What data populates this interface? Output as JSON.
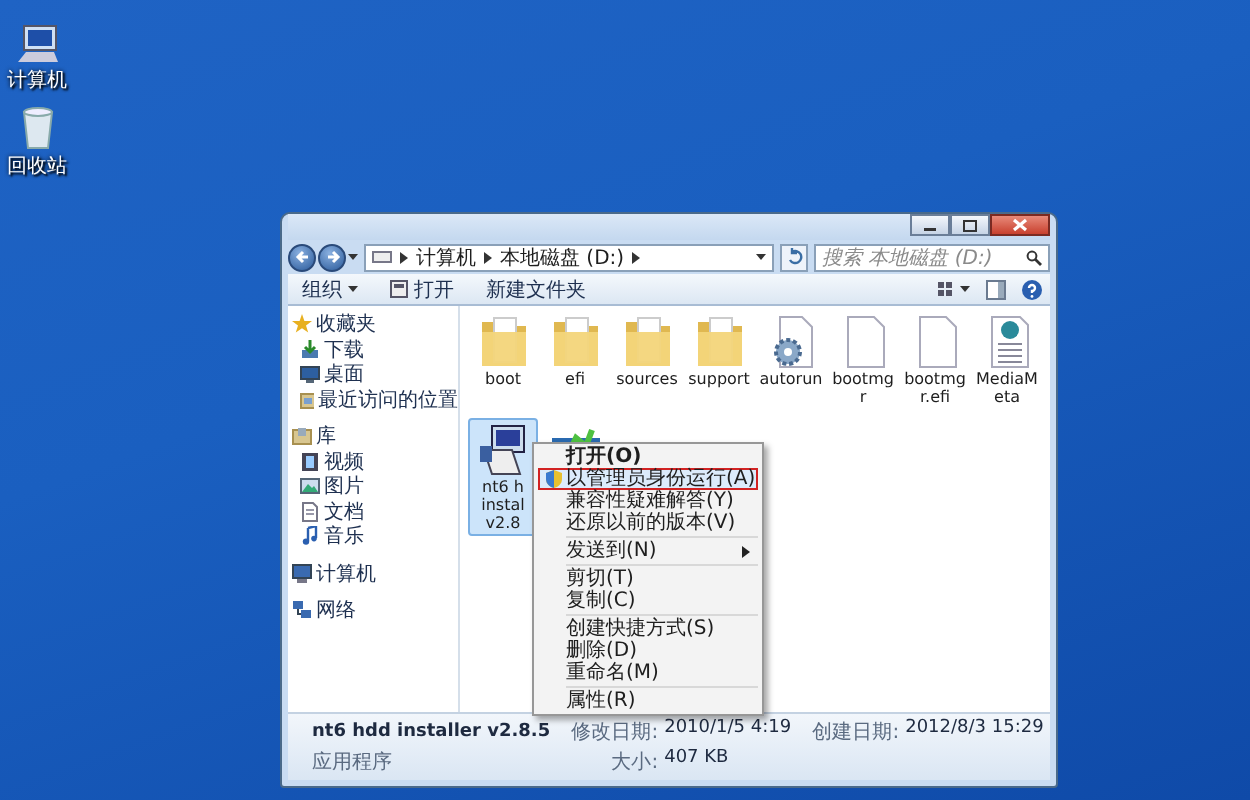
{
  "desktop_icons": [
    {
      "label": "计算机",
      "kind": "computer"
    },
    {
      "label": "回收站",
      "kind": "recycle"
    }
  ],
  "address_bar": {
    "breadcrumb": [
      "计算机",
      "本地磁盘 (D:)"
    ]
  },
  "search": {
    "placeholder": "搜索 本地磁盘 (D:)"
  },
  "toolbar": {
    "items": [
      {
        "label": "组织",
        "kind": "dropdown"
      },
      {
        "label": "打开",
        "kind": "open"
      },
      {
        "label": "新建文件夹",
        "kind": "plain"
      }
    ]
  },
  "sidebar": {
    "groups": [
      {
        "label": "收藏夹",
        "kind": "star",
        "children": [
          {
            "label": "下载",
            "kind": "download"
          },
          {
            "label": "桌面",
            "kind": "desktop"
          },
          {
            "label": "最近访问的位置",
            "kind": "recent"
          }
        ]
      },
      {
        "label": "库",
        "kind": "library",
        "children": [
          {
            "label": "视频",
            "kind": "video"
          },
          {
            "label": "图片",
            "kind": "picture"
          },
          {
            "label": "文档",
            "kind": "document"
          },
          {
            "label": "音乐",
            "kind": "music"
          }
        ]
      },
      {
        "label": "计算机",
        "kind": "computer"
      },
      {
        "label": "网络",
        "kind": "network"
      }
    ]
  },
  "files": [
    {
      "name": "boot",
      "kind": "folder",
      "selected": false
    },
    {
      "name": "efi",
      "kind": "folder",
      "selected": false
    },
    {
      "name": "sources",
      "kind": "folder",
      "selected": false
    },
    {
      "name": "support",
      "kind": "folder",
      "selected": false
    },
    {
      "name": "autorun",
      "kind": "settings",
      "selected": false
    },
    {
      "name": "bootmgr",
      "kind": "file",
      "selected": false
    },
    {
      "name": "bootmgr.efi",
      "kind": "file",
      "selected": false
    },
    {
      "name": "MediaMeta",
      "kind": "web",
      "selected": false
    },
    {
      "name": "nt6 h\ninstal\nv2.8",
      "kind": "installer",
      "selected": true
    },
    {
      "kind": "setup",
      "selected": false
    }
  ],
  "context_menu": [
    {
      "kind": "item",
      "label": "打开(O)",
      "default": true
    },
    {
      "kind": "item",
      "label": "以管理员身份运行(A)",
      "shield": true,
      "highlighted": true
    },
    {
      "kind": "item",
      "label": "兼容性疑难解答(Y)"
    },
    {
      "kind": "item",
      "label": "还原以前的版本(V)"
    },
    {
      "kind": "separator"
    },
    {
      "kind": "item",
      "label": "发送到(N)",
      "submenu": true
    },
    {
      "kind": "separator"
    },
    {
      "kind": "item",
      "label": "剪切(T)"
    },
    {
      "kind": "item",
      "label": "复制(C)"
    },
    {
      "kind": "separator"
    },
    {
      "kind": "item",
      "label": "创建快捷方式(S)"
    },
    {
      "kind": "item",
      "label": "删除(D)"
    },
    {
      "kind": "item",
      "label": "重命名(M)"
    },
    {
      "kind": "separator"
    },
    {
      "kind": "item",
      "label": "属性(R)"
    }
  ],
  "details": {
    "name": "nt6 hdd installer v2.8.5",
    "type": "应用程序",
    "fields": [
      {
        "label": "修改日期:",
        "value": "2010/1/5 4:19"
      },
      {
        "label": "大小:",
        "value": "407 KB"
      },
      {
        "label": "创建日期:",
        "value": "2012/8/3 15:29"
      }
    ]
  }
}
